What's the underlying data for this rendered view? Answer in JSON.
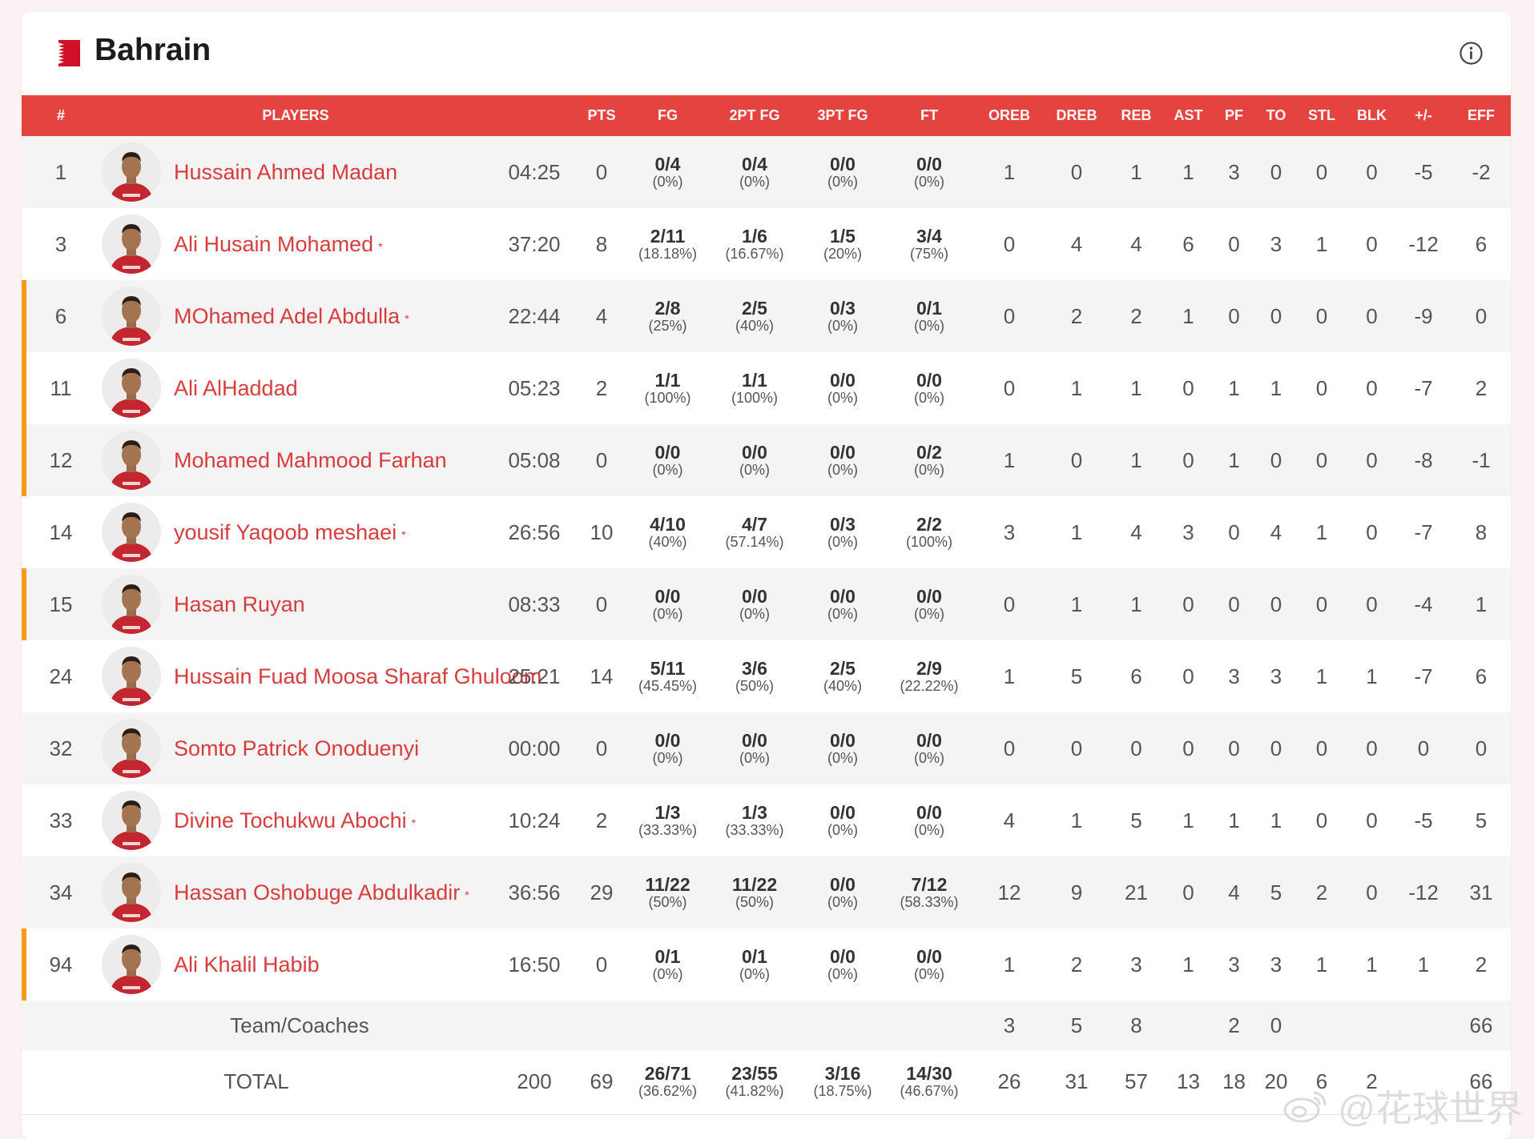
{
  "team": {
    "name": "Bahrain",
    "flag_colors": {
      "white": "#ffffff",
      "red": "#ce1126"
    }
  },
  "colors": {
    "header_bg": "#e5433f",
    "player_name": "#d83c3c",
    "bench_marker": "#f09b1b"
  },
  "columns": [
    "#",
    "PLAYERS",
    "",
    "PTS",
    "FG",
    "2PT FG",
    "3PT FG",
    "FT",
    "OREB",
    "DREB",
    "REB",
    "AST",
    "PF",
    "TO",
    "STL",
    "BLK",
    "+/-",
    "EFF"
  ],
  "players": [
    {
      "num": "1",
      "name": "Hussain Ahmed Madan",
      "starter": "",
      "bench": false,
      "min": "04:25",
      "pts": "0",
      "fg": "0/4",
      "fg_pct": "(0%)",
      "fg2": "0/4",
      "fg2_pct": "(0%)",
      "fg3": "0/0",
      "fg3_pct": "(0%)",
      "ft": "0/0",
      "ft_pct": "(0%)",
      "oreb": "1",
      "dreb": "0",
      "reb": "1",
      "ast": "1",
      "pf": "3",
      "to": "0",
      "stl": "0",
      "blk": "0",
      "pm": "-5",
      "eff": "-2"
    },
    {
      "num": "3",
      "name": "Ali Husain Mohamed",
      "starter": "*",
      "bench": false,
      "min": "37:20",
      "pts": "8",
      "fg": "2/11",
      "fg_pct": "(18.18%)",
      "fg2": "1/6",
      "fg2_pct": "(16.67%)",
      "fg3": "1/5",
      "fg3_pct": "(20%)",
      "ft": "3/4",
      "ft_pct": "(75%)",
      "oreb": "0",
      "dreb": "4",
      "reb": "4",
      "ast": "6",
      "pf": "0",
      "to": "3",
      "stl": "1",
      "blk": "0",
      "pm": "-12",
      "eff": "6"
    },
    {
      "num": "6",
      "name": "MOhamed Adel Abdulla",
      "starter": "*",
      "bench": true,
      "min": "22:44",
      "pts": "4",
      "fg": "2/8",
      "fg_pct": "(25%)",
      "fg2": "2/5",
      "fg2_pct": "(40%)",
      "fg3": "0/3",
      "fg3_pct": "(0%)",
      "ft": "0/1",
      "ft_pct": "(0%)",
      "oreb": "0",
      "dreb": "2",
      "reb": "2",
      "ast": "1",
      "pf": "0",
      "to": "0",
      "stl": "0",
      "blk": "0",
      "pm": "-9",
      "eff": "0"
    },
    {
      "num": "11",
      "name": "Ali AlHaddad",
      "starter": "",
      "bench": true,
      "min": "05:23",
      "pts": "2",
      "fg": "1/1",
      "fg_pct": "(100%)",
      "fg2": "1/1",
      "fg2_pct": "(100%)",
      "fg3": "0/0",
      "fg3_pct": "(0%)",
      "ft": "0/0",
      "ft_pct": "(0%)",
      "oreb": "0",
      "dreb": "1",
      "reb": "1",
      "ast": "0",
      "pf": "1",
      "to": "1",
      "stl": "0",
      "blk": "0",
      "pm": "-7",
      "eff": "2"
    },
    {
      "num": "12",
      "name": "Mohamed Mahmood Farhan",
      "starter": "",
      "bench": true,
      "min": "05:08",
      "pts": "0",
      "fg": "0/0",
      "fg_pct": "(0%)",
      "fg2": "0/0",
      "fg2_pct": "(0%)",
      "fg3": "0/0",
      "fg3_pct": "(0%)",
      "ft": "0/2",
      "ft_pct": "(0%)",
      "oreb": "1",
      "dreb": "0",
      "reb": "1",
      "ast": "0",
      "pf": "1",
      "to": "0",
      "stl": "0",
      "blk": "0",
      "pm": "-8",
      "eff": "-1"
    },
    {
      "num": "14",
      "name": "yousif Yaqoob meshaei",
      "starter": "*",
      "bench": false,
      "min": "26:56",
      "pts": "10",
      "fg": "4/10",
      "fg_pct": "(40%)",
      "fg2": "4/7",
      "fg2_pct": "(57.14%)",
      "fg3": "0/3",
      "fg3_pct": "(0%)",
      "ft": "2/2",
      "ft_pct": "(100%)",
      "oreb": "3",
      "dreb": "1",
      "reb": "4",
      "ast": "3",
      "pf": "0",
      "to": "4",
      "stl": "1",
      "blk": "0",
      "pm": "-7",
      "eff": "8"
    },
    {
      "num": "15",
      "name": "Hasan Ruyan",
      "starter": "",
      "bench": true,
      "min": "08:33",
      "pts": "0",
      "fg": "0/0",
      "fg_pct": "(0%)",
      "fg2": "0/0",
      "fg2_pct": "(0%)",
      "fg3": "0/0",
      "fg3_pct": "(0%)",
      "ft": "0/0",
      "ft_pct": "(0%)",
      "oreb": "0",
      "dreb": "1",
      "reb": "1",
      "ast": "0",
      "pf": "0",
      "to": "0",
      "stl": "0",
      "blk": "0",
      "pm": "-4",
      "eff": "1"
    },
    {
      "num": "24",
      "name": "Hussain Fuad Moosa Sharaf Ghuloom",
      "starter": "",
      "bench": false,
      "min": "25:21",
      "pts": "14",
      "fg": "5/11",
      "fg_pct": "(45.45%)",
      "fg2": "3/6",
      "fg2_pct": "(50%)",
      "fg3": "2/5",
      "fg3_pct": "(40%)",
      "ft": "2/9",
      "ft_pct": "(22.22%)",
      "oreb": "1",
      "dreb": "5",
      "reb": "6",
      "ast": "0",
      "pf": "3",
      "to": "3",
      "stl": "1",
      "blk": "1",
      "pm": "-7",
      "eff": "6"
    },
    {
      "num": "32",
      "name": "Somto Patrick Onoduenyi",
      "starter": "",
      "bench": false,
      "min": "00:00",
      "pts": "0",
      "fg": "0/0",
      "fg_pct": "(0%)",
      "fg2": "0/0",
      "fg2_pct": "(0%)",
      "fg3": "0/0",
      "fg3_pct": "(0%)",
      "ft": "0/0",
      "ft_pct": "(0%)",
      "oreb": "0",
      "dreb": "0",
      "reb": "0",
      "ast": "0",
      "pf": "0",
      "to": "0",
      "stl": "0",
      "blk": "0",
      "pm": "0",
      "eff": "0"
    },
    {
      "num": "33",
      "name": "Divine Tochukwu Abochi",
      "starter": "*",
      "bench": false,
      "min": "10:24",
      "pts": "2",
      "fg": "1/3",
      "fg_pct": "(33.33%)",
      "fg2": "1/3",
      "fg2_pct": "(33.33%)",
      "fg3": "0/0",
      "fg3_pct": "(0%)",
      "ft": "0/0",
      "ft_pct": "(0%)",
      "oreb": "4",
      "dreb": "1",
      "reb": "5",
      "ast": "1",
      "pf": "1",
      "to": "1",
      "stl": "0",
      "blk": "0",
      "pm": "-5",
      "eff": "5"
    },
    {
      "num": "34",
      "name": "Hassan Oshobuge Abdulkadir",
      "starter": "*",
      "bench": false,
      "min": "36:56",
      "pts": "29",
      "fg": "11/22",
      "fg_pct": "(50%)",
      "fg2": "11/22",
      "fg2_pct": "(50%)",
      "fg3": "0/0",
      "fg3_pct": "(0%)",
      "ft": "7/12",
      "ft_pct": "(58.33%)",
      "oreb": "12",
      "dreb": "9",
      "reb": "21",
      "ast": "0",
      "pf": "4",
      "to": "5",
      "stl": "2",
      "blk": "0",
      "pm": "-12",
      "eff": "31"
    },
    {
      "num": "94",
      "name": "Ali Khalil Habib",
      "starter": "",
      "bench": true,
      "min": "16:50",
      "pts": "0",
      "fg": "0/1",
      "fg_pct": "(0%)",
      "fg2": "0/1",
      "fg2_pct": "(0%)",
      "fg3": "0/0",
      "fg3_pct": "(0%)",
      "ft": "0/0",
      "ft_pct": "(0%)",
      "oreb": "1",
      "dreb": "2",
      "reb": "3",
      "ast": "1",
      "pf": "3",
      "to": "3",
      "stl": "1",
      "blk": "1",
      "pm": "1",
      "eff": "2"
    }
  ],
  "team_row": {
    "label": "Team/Coaches",
    "oreb": "3",
    "dreb": "5",
    "reb": "8",
    "pf": "2",
    "to": "0",
    "eff": "66"
  },
  "total_row": {
    "label": "TOTAL",
    "min": "200",
    "pts": "69",
    "fg": "26/71",
    "fg_pct": "(36.62%)",
    "fg2": "23/55",
    "fg2_pct": "(41.82%)",
    "fg3": "3/16",
    "fg3_pct": "(18.75%)",
    "ft": "14/30",
    "ft_pct": "(46.67%)",
    "oreb": "26",
    "dreb": "31",
    "reb": "57",
    "ast": "13",
    "pf": "18",
    "to": "20",
    "stl": "6",
    "blk": "2",
    "eff": "66"
  },
  "icons": {
    "info": "info-icon",
    "weibo": "weibo-logo-icon"
  },
  "watermark": {
    "text": "@花球世界"
  }
}
